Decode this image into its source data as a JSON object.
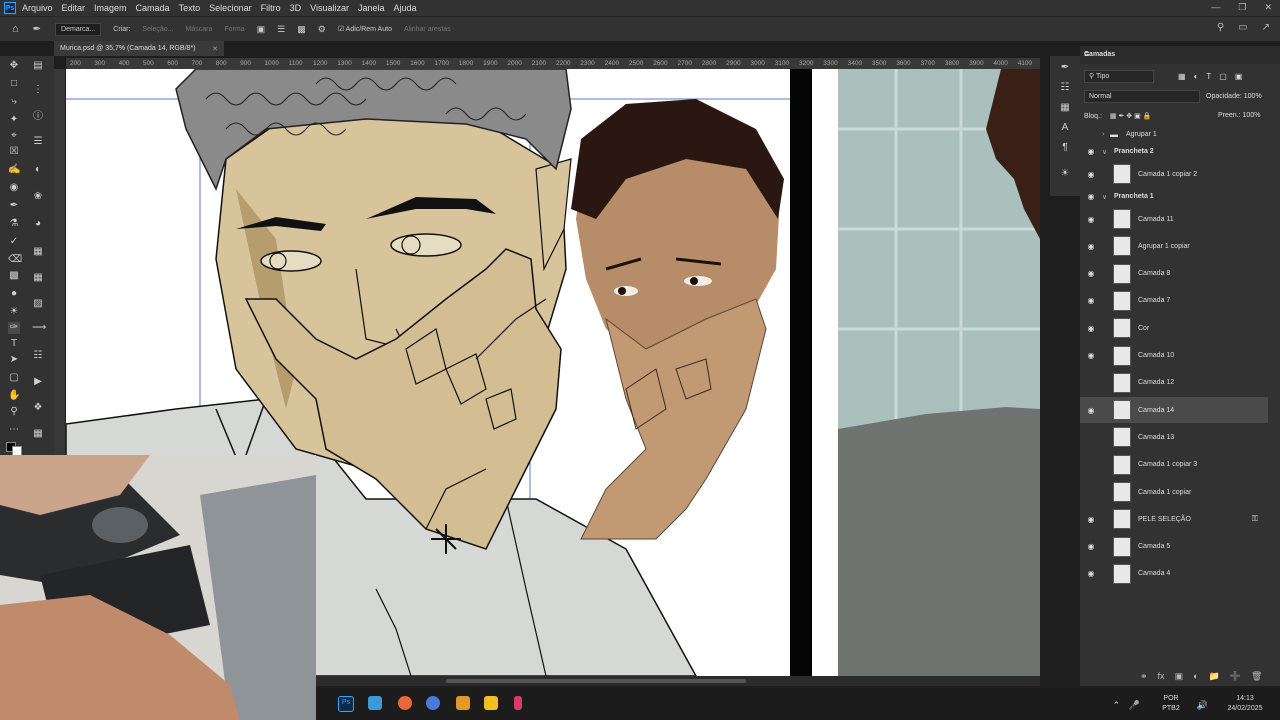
{
  "menu": [
    "Arquivo",
    "Editar",
    "Imagem",
    "Camada",
    "Texto",
    "Selecionar",
    "Filtro",
    "3D",
    "Visualizar",
    "Janela",
    "Ajuda"
  ],
  "app_icon_label": "Ps",
  "options_bar": {
    "mode_label": "Demarca...",
    "create_label": "Criar:",
    "selection_label": "Seleção...",
    "mask_label": "Máscara",
    "shape_label": "Forma",
    "auto_add_label": "Adic/Rem Auto",
    "align_edges_label": "Alinhar arestas"
  },
  "document_tab": {
    "title": "Murica.psd @ 35,7% (Camada 14, RGB/8*)"
  },
  "ruler_labels": [
    "200",
    "300",
    "400",
    "500",
    "600",
    "700",
    "800",
    "900",
    "1000",
    "1100",
    "1200",
    "1300",
    "1400",
    "1500",
    "1600",
    "1700",
    "1800",
    "1900",
    "2000",
    "2100",
    "2200",
    "2300",
    "2400",
    "2500",
    "2600",
    "2700",
    "2800",
    "2900",
    "3000",
    "3100",
    "3200",
    "3300",
    "3400",
    "3500",
    "3600",
    "3700",
    "3800",
    "3900",
    "4000",
    "4100",
    "4200"
  ],
  "layers_panel": {
    "title": "Camadas",
    "filter": "Tipo",
    "blend_mode": "Normal",
    "opacity_label": "Opacidade:",
    "opacity_value": "100%",
    "lock_label": "Bloq.:",
    "fill_label": "Preen.:",
    "fill_value": "100%",
    "layers": [
      {
        "name": "Agrupar 1",
        "type": "folder",
        "visible": false
      },
      {
        "name": "Prancheta 2",
        "type": "group",
        "visible": true
      },
      {
        "name": "Camada 1 copiar 2",
        "type": "layer",
        "visible": true
      },
      {
        "name": "Prancheta 1",
        "type": "group",
        "visible": true
      },
      {
        "name": "Camada 11",
        "type": "layer",
        "visible": true
      },
      {
        "name": "Agrupar 1 copiar",
        "type": "layer",
        "visible": true
      },
      {
        "name": "Camada 8",
        "type": "layer",
        "visible": true
      },
      {
        "name": "Camada 7",
        "type": "layer",
        "visible": true
      },
      {
        "name": "Cor",
        "type": "layer",
        "visible": true
      },
      {
        "name": "Camada 10",
        "type": "layer",
        "visible": true
      },
      {
        "name": "Camada 12",
        "type": "layer",
        "visible": false
      },
      {
        "name": "Camada 14",
        "type": "layer",
        "visible": true,
        "selected": true
      },
      {
        "name": "Camada 13",
        "type": "layer",
        "visible": false
      },
      {
        "name": "Camada 1 copiar 3",
        "type": "layer",
        "visible": false
      },
      {
        "name": "Camada 1 copiar",
        "type": "layer",
        "visible": false
      },
      {
        "name": "PELE SELEÇÃO",
        "type": "layer",
        "visible": true,
        "locked": true
      },
      {
        "name": "Camada 5",
        "type": "layer",
        "visible": true
      },
      {
        "name": "Camada 4",
        "type": "layer",
        "visible": true
      }
    ]
  },
  "tray": {
    "language": "POR",
    "layout": "PTB2",
    "time": "14:13",
    "date": "24/02/2025"
  }
}
